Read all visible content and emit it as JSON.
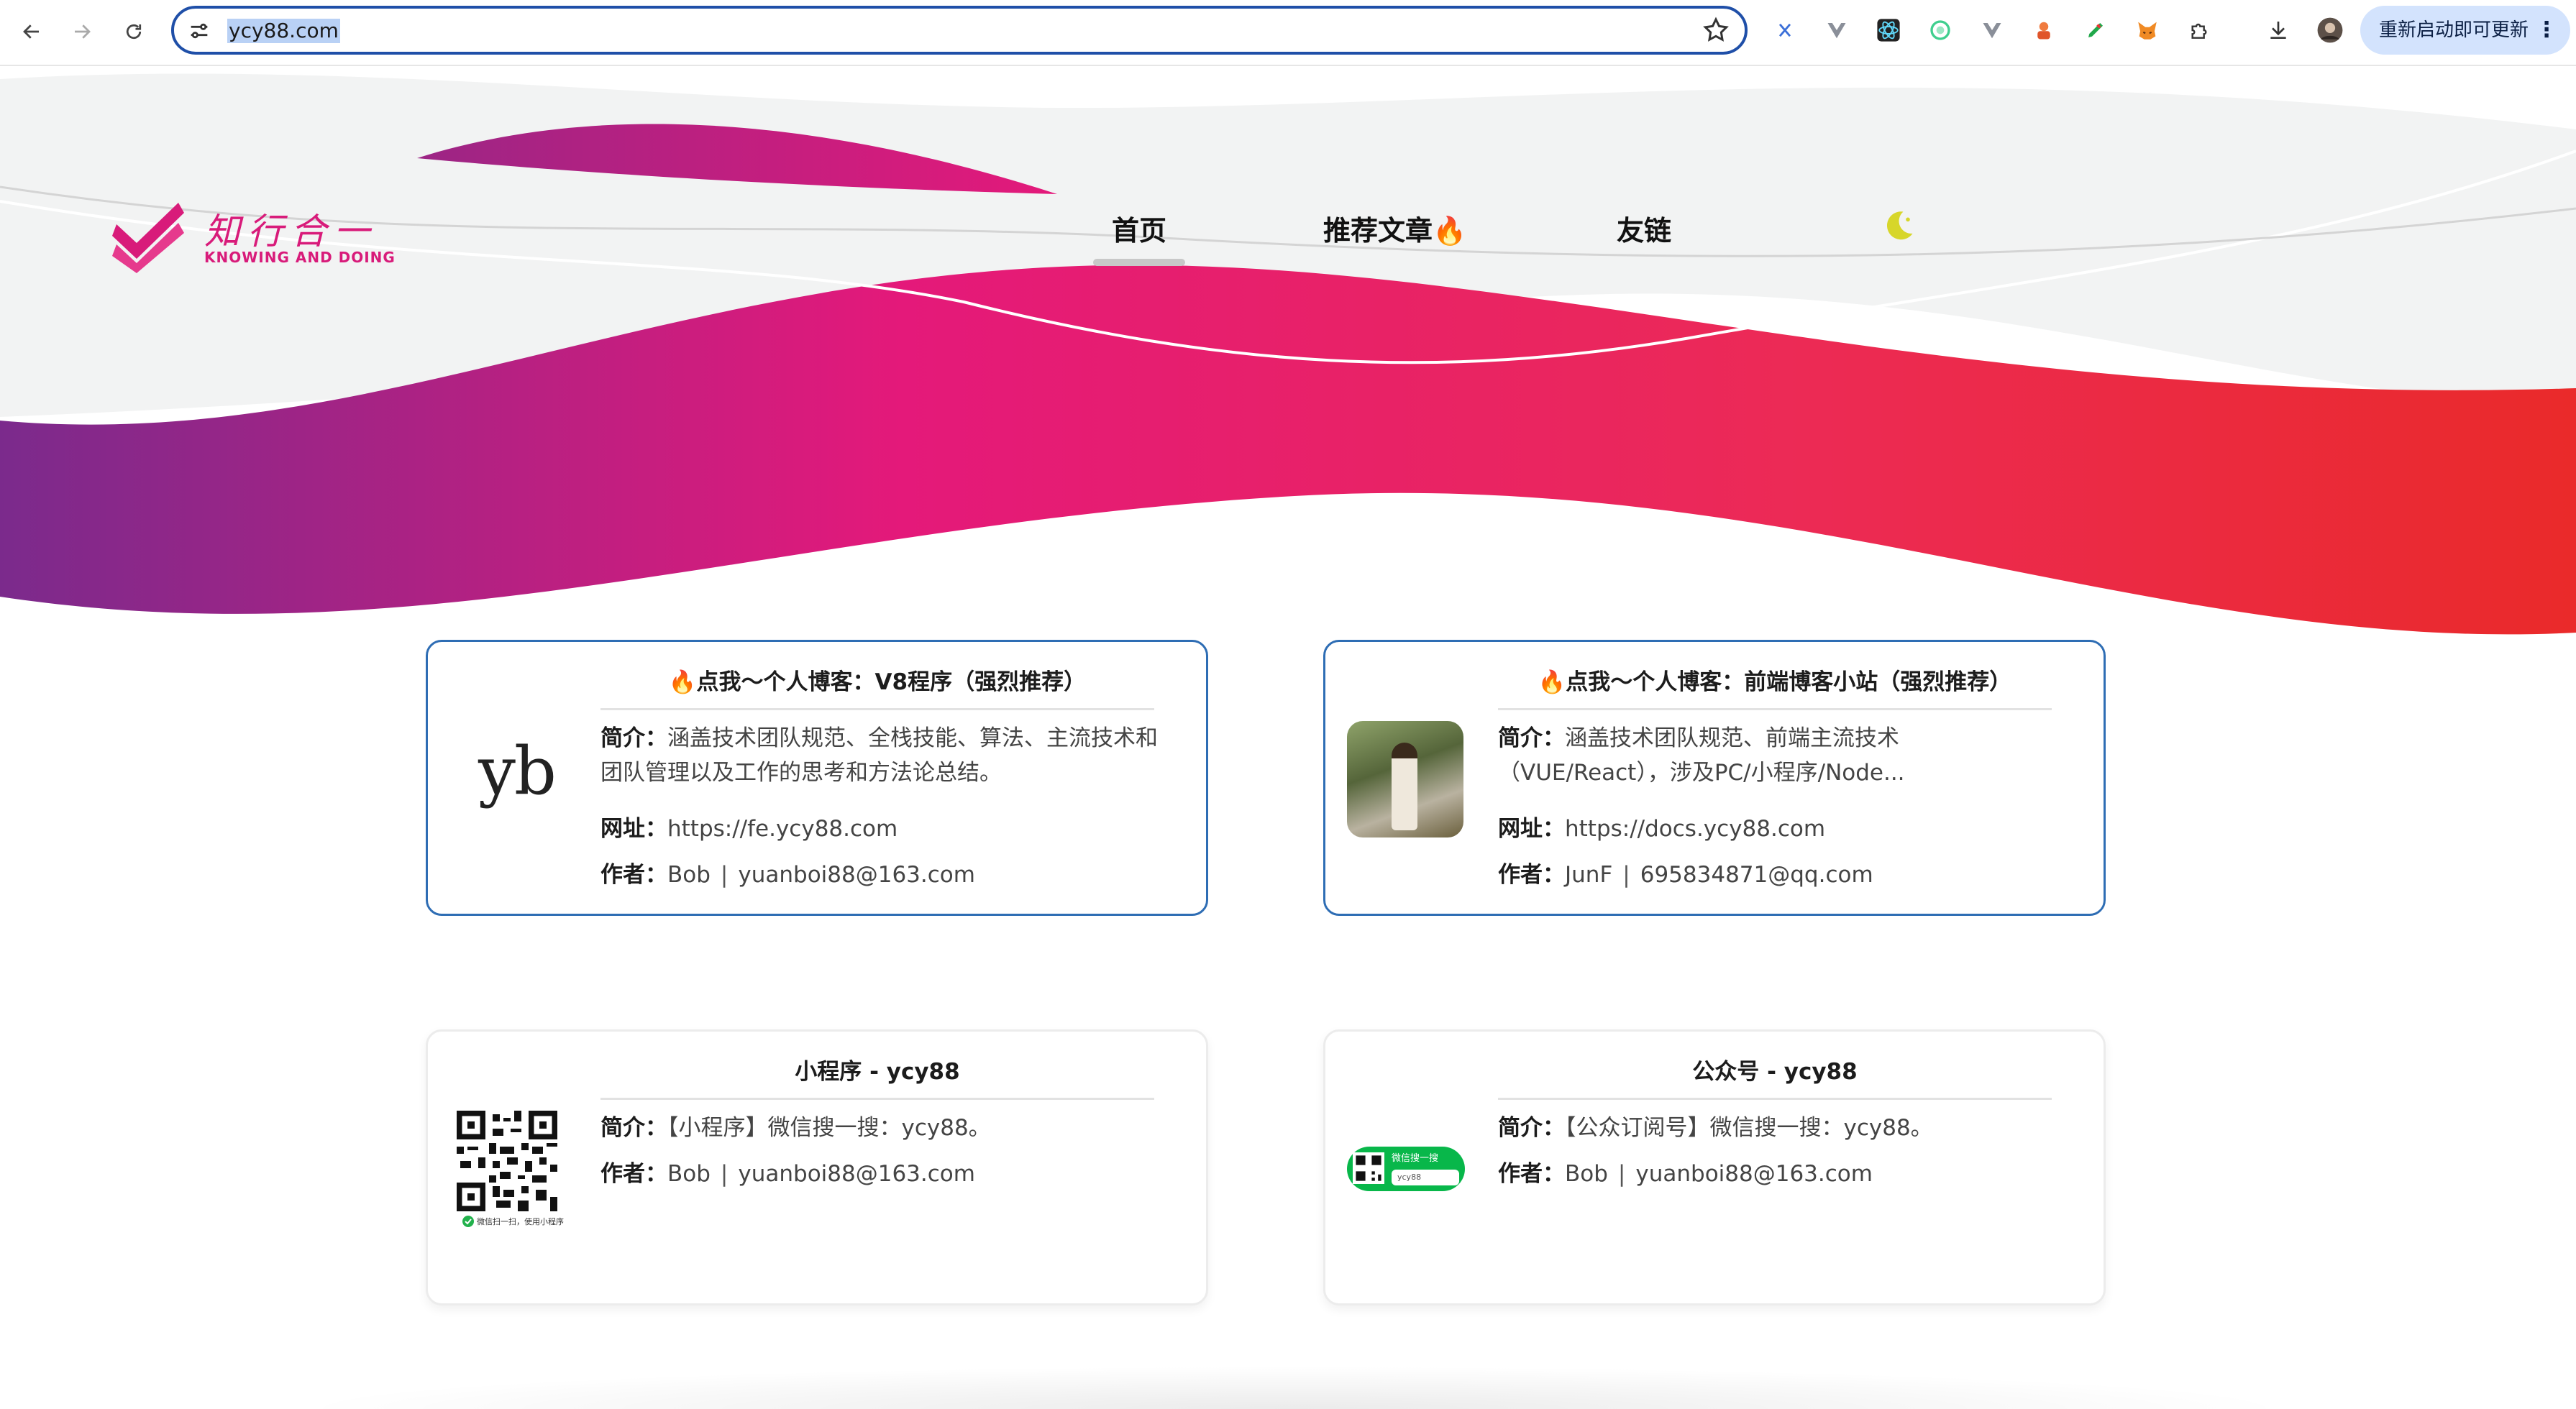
{
  "browser": {
    "url": "ycy88.com",
    "update_label": "重新启动即可更新",
    "menu_glyph": "⋮"
  },
  "site": {
    "logo_title": "知行合一",
    "logo_subtitle": "KNOWING AND DOING",
    "nav": [
      {
        "label": "首页",
        "active": true
      },
      {
        "label": "推荐文章🔥",
        "active": false
      },
      {
        "label": "友链",
        "active": false
      }
    ],
    "theme_icon": "moon-icon"
  },
  "colors": {
    "brand_pink": "#e4197a",
    "wave_purple": "#7b2a8c",
    "wave_red": "#ea2a2a",
    "card_border_blue": "#2e6db4",
    "omnibox_blue": "#1f4fa8"
  },
  "cards": [
    {
      "title": "🔥点我～个人博客：V8程序（强烈推荐）",
      "intro_label": "简介：",
      "intro": "涵盖技术团队规范、全栈技能、算法、主流技术和团队管理以及工作的思考和方法论总结。",
      "url_label": "网址：",
      "url": "https://fe.ycy88.com",
      "author_label": "作者：",
      "author": "Bob",
      "email": "yuanboi88@163.com",
      "thumb_text": "yb"
    },
    {
      "title": "🔥点我～个人博客：前端博客小站（强烈推荐）",
      "intro_label": "简介：",
      "intro": "涵盖技术团队规范、前端主流技术（VUE/React），涉及PC/小程序/Node...",
      "url_label": "网址：",
      "url": "https://docs.ycy88.com",
      "author_label": "作者：",
      "author": "JunF",
      "email": "695834871@qq.com"
    },
    {
      "title": "小程序 - ycy88",
      "intro_label": "简介：",
      "intro": "【小程序】微信搜一搜：ycy88。",
      "author_label": "作者：",
      "author": "Bob",
      "email": "yuanboi88@163.com",
      "qr_caption": "微信扫一扫，使用小程序"
    },
    {
      "title": "公众号 - ycy88",
      "intro_label": "简介：",
      "intro": "【公众订阅号】微信搜一搜：ycy88。",
      "author_label": "作者：",
      "author": "Bob",
      "email": "yuanboi88@163.com",
      "badge_text": "微信搜一搜",
      "badge_sub": "ycy88"
    }
  ]
}
